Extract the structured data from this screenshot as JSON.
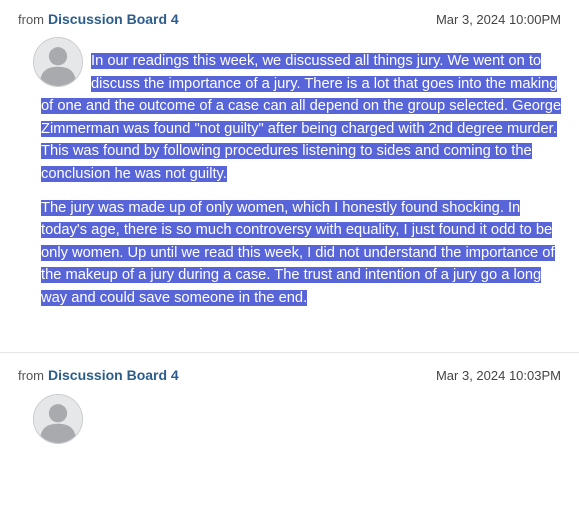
{
  "posts": [
    {
      "from_label": "from",
      "board": "Discussion Board 4",
      "timestamp": "Mar 3, 2024 10:00PM",
      "avatar_icon": "default-user-avatar-icon",
      "paragraphs": [
        "In our readings this week, we discussed all things jury. We went on to discuss the importance of a jury. There is a lot that goes into the making of one and the outcome of a case can all depend on the group selected.   George Zimmerman was found \"not guilty\" after being charged with 2nd degree murder. This was found by following procedures listening to sides and coming to the conclusion he was not guilty.",
        "The jury was made up of only women, which I honestly found shocking. In today's age, there is so much controversy with equality, I just found it odd to be only women. Up until we read this week, I did not understand the importance of the makeup of a jury during a case.  The trust and intention of a jury go a long way and could save someone in the end."
      ],
      "selection_color": "#5865d8"
    },
    {
      "from_label": "from",
      "board": "Discussion Board 4",
      "timestamp": "Mar 3, 2024 10:03PM",
      "avatar_icon": "default-user-avatar-icon"
    }
  ],
  "colors": {
    "link": "#2b5d8c",
    "divider": "#e5e7ea"
  }
}
